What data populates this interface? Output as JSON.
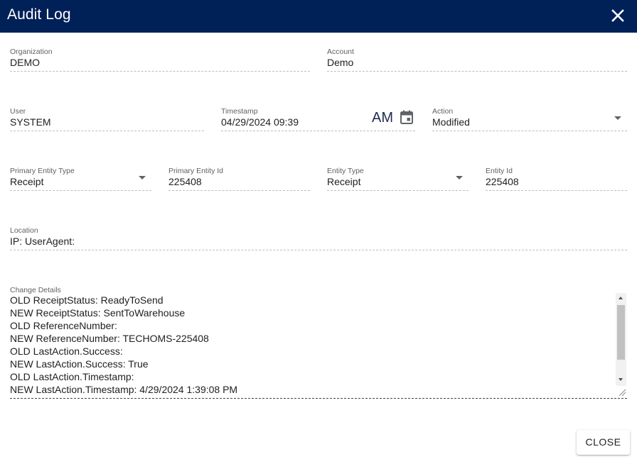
{
  "dialog": {
    "title": "Audit Log",
    "close_icon": "close-icon",
    "header_color": "#002058"
  },
  "fields": {
    "organization": {
      "label": "Organization",
      "value": "DEMO"
    },
    "account": {
      "label": "Account",
      "value": "Demo"
    },
    "user": {
      "label": "User",
      "value": "SYSTEM"
    },
    "timestamp": {
      "label": "Timestamp",
      "value": "04/29/2024 09:39",
      "ampm": "AM",
      "icon": "calendar-icon"
    },
    "action": {
      "label": "Action",
      "value": "Modified"
    },
    "primary_entity_type": {
      "label": "Primary Entity Type",
      "value": "Receipt"
    },
    "primary_entity_id": {
      "label": "Primary Entity Id",
      "value": "225408"
    },
    "entity_type": {
      "label": "Entity Type",
      "value": "Receipt"
    },
    "entity_id": {
      "label": "Entity Id",
      "value": "225408"
    },
    "location": {
      "label": "Location",
      "value": "IP: UserAgent:"
    }
  },
  "change_details": {
    "label": "Change Details",
    "lines": [
      "OLD ReceiptStatus: ReadyToSend",
      "NEW ReceiptStatus: SentToWarehouse",
      "OLD ReferenceNumber:",
      "NEW ReferenceNumber: TECHOMS-225408",
      "OLD LastAction.Success:",
      "NEW LastAction.Success: True",
      "OLD LastAction.Timestamp:",
      "NEW LastAction.Timestamp: 4/29/2024 1:39:08 PM"
    ]
  },
  "footer": {
    "close_label": "CLOSE"
  }
}
